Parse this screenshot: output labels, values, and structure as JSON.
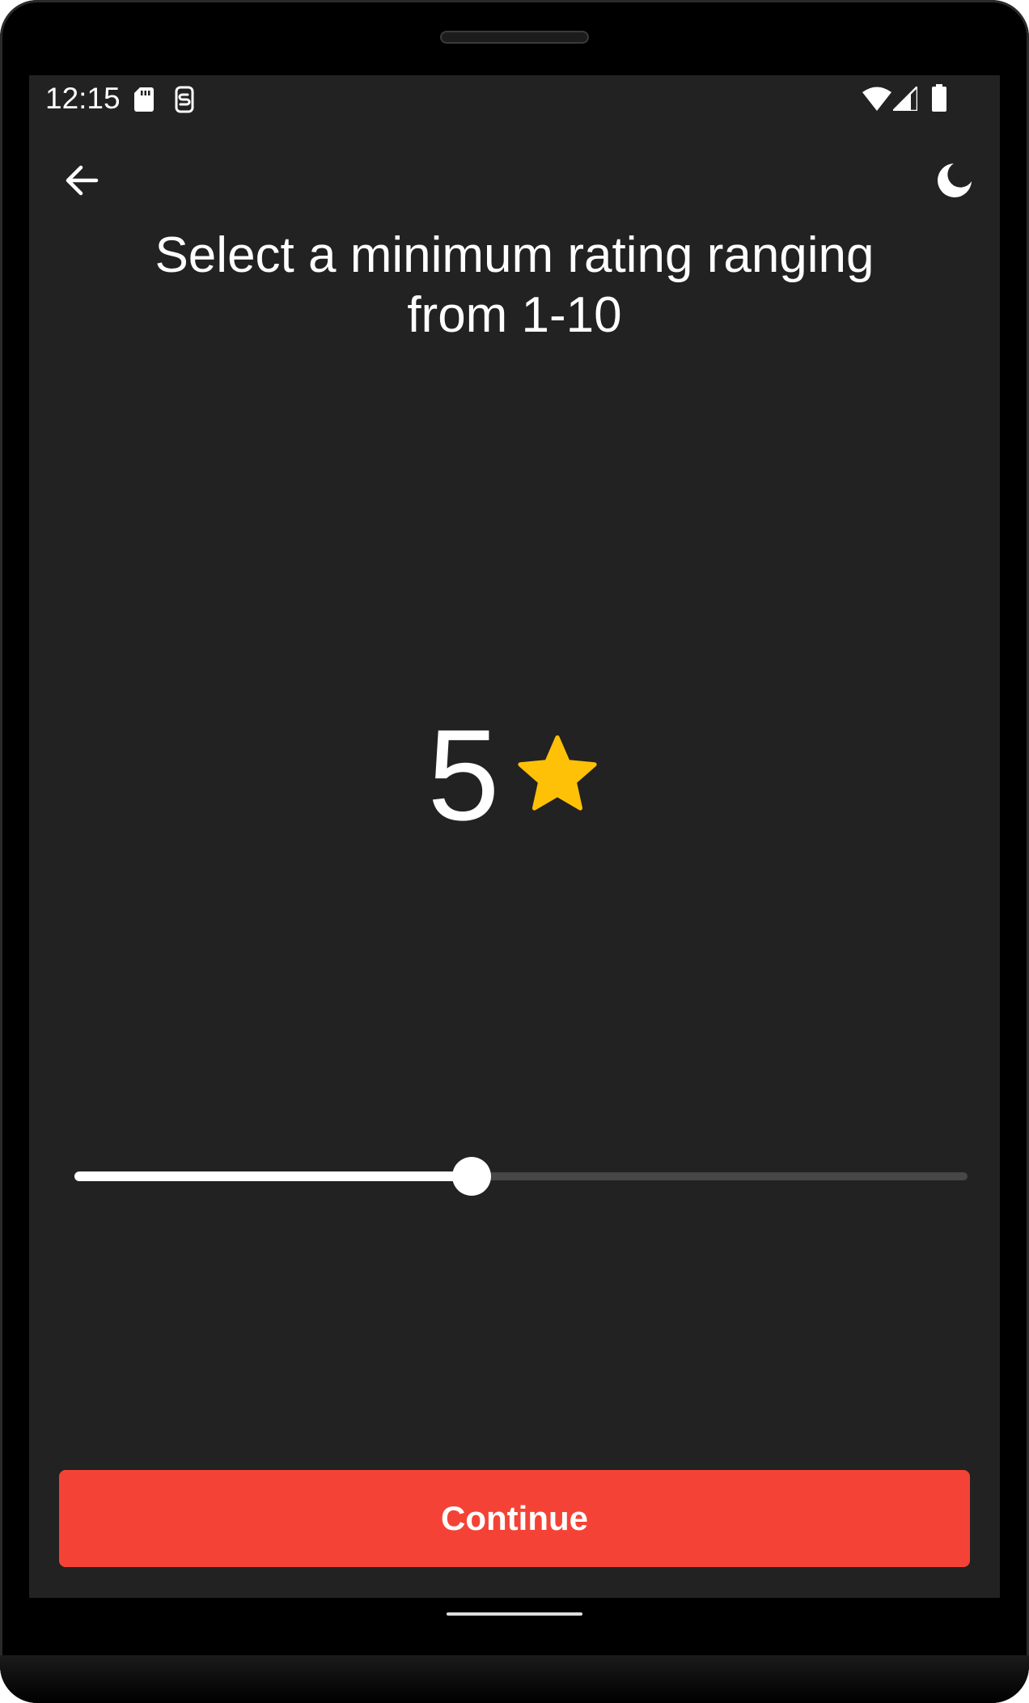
{
  "status_bar": {
    "time": "12:15",
    "icons": [
      "sd-card-icon",
      "screenshot-icon",
      "wifi-icon",
      "signal-icon",
      "battery-icon"
    ]
  },
  "app_bar": {
    "back_icon": "arrow-left-icon",
    "theme_icon": "moon-icon"
  },
  "prompt": {
    "title": "Select a minimum rating ranging from 1-10"
  },
  "rating": {
    "value": "5",
    "icon": "star-icon",
    "star_color": "#FFC107"
  },
  "slider": {
    "min": 1,
    "max": 10,
    "value": 5
  },
  "actions": {
    "continue_label": "Continue",
    "continue_color": "#F44336"
  },
  "colors": {
    "background": "#222222",
    "text": "#FFFFFF",
    "track_inactive": "#474747"
  }
}
